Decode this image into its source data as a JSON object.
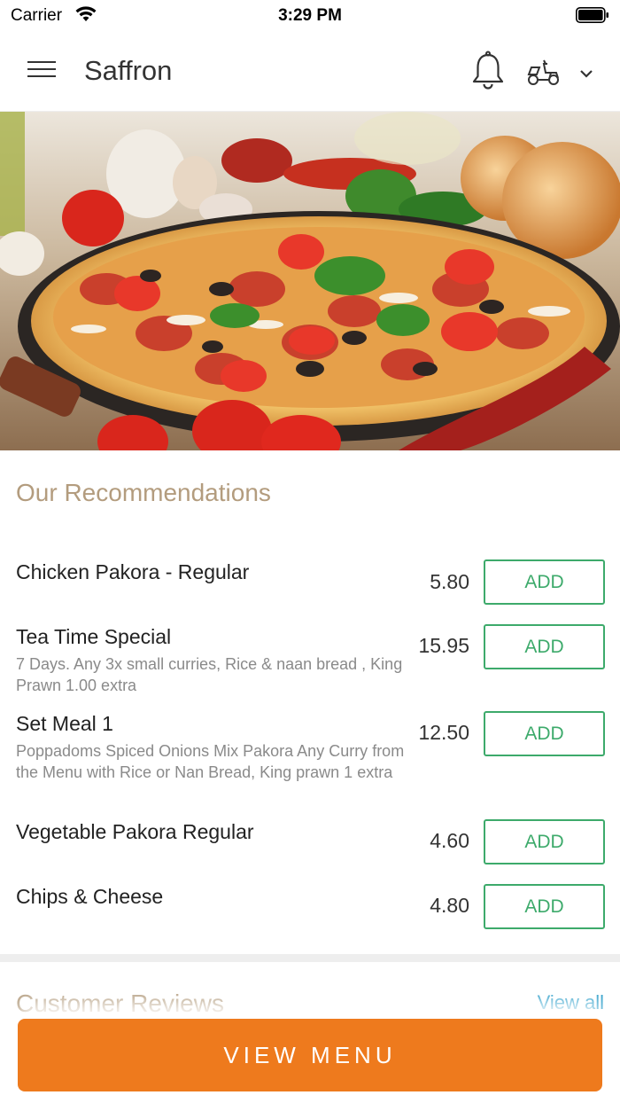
{
  "status_bar": {
    "carrier": "Carrier",
    "time": "3:29 PM"
  },
  "header": {
    "title": "Saffron",
    "icons": [
      "menu-icon",
      "bell-icon",
      "scooter-icon",
      "chevron-down-icon"
    ]
  },
  "hero": {
    "image": "pizza-photo"
  },
  "recommendations": {
    "title": "Our Recommendations",
    "items": [
      {
        "name": "Chicken Pakora - Regular",
        "description": "",
        "price": "5.80",
        "button": "ADD"
      },
      {
        "name": "Tea Time Special",
        "description": "7 Days.  Any 3x small curries,  Rice & naan bread , King Prawn 1.00 extra",
        "price": "15.95",
        "button": "ADD"
      },
      {
        "name": "Set Meal 1",
        "description": "Poppadoms  Spiced Onions  Mix Pakora  Any Curry from the Menu  with Rice or Nan Bread,  King prawn 1 extra",
        "price": "12.50",
        "button": "ADD"
      },
      {
        "name": "Vegetable Pakora Regular",
        "description": "",
        "price": "4.60",
        "button": "ADD"
      },
      {
        "name": "Chips & Cheese",
        "description": "",
        "price": "4.80",
        "button": "ADD"
      }
    ]
  },
  "reviews": {
    "title": "Customer Reviews",
    "view_all": "View all"
  },
  "footer": {
    "view_menu": "VIEW MENU"
  },
  "colors": {
    "accent_orange": "#ee7a1d",
    "add_green": "#3daa6b",
    "section_gold": "#b39c7e",
    "link_blue": "#2a9dc9"
  }
}
